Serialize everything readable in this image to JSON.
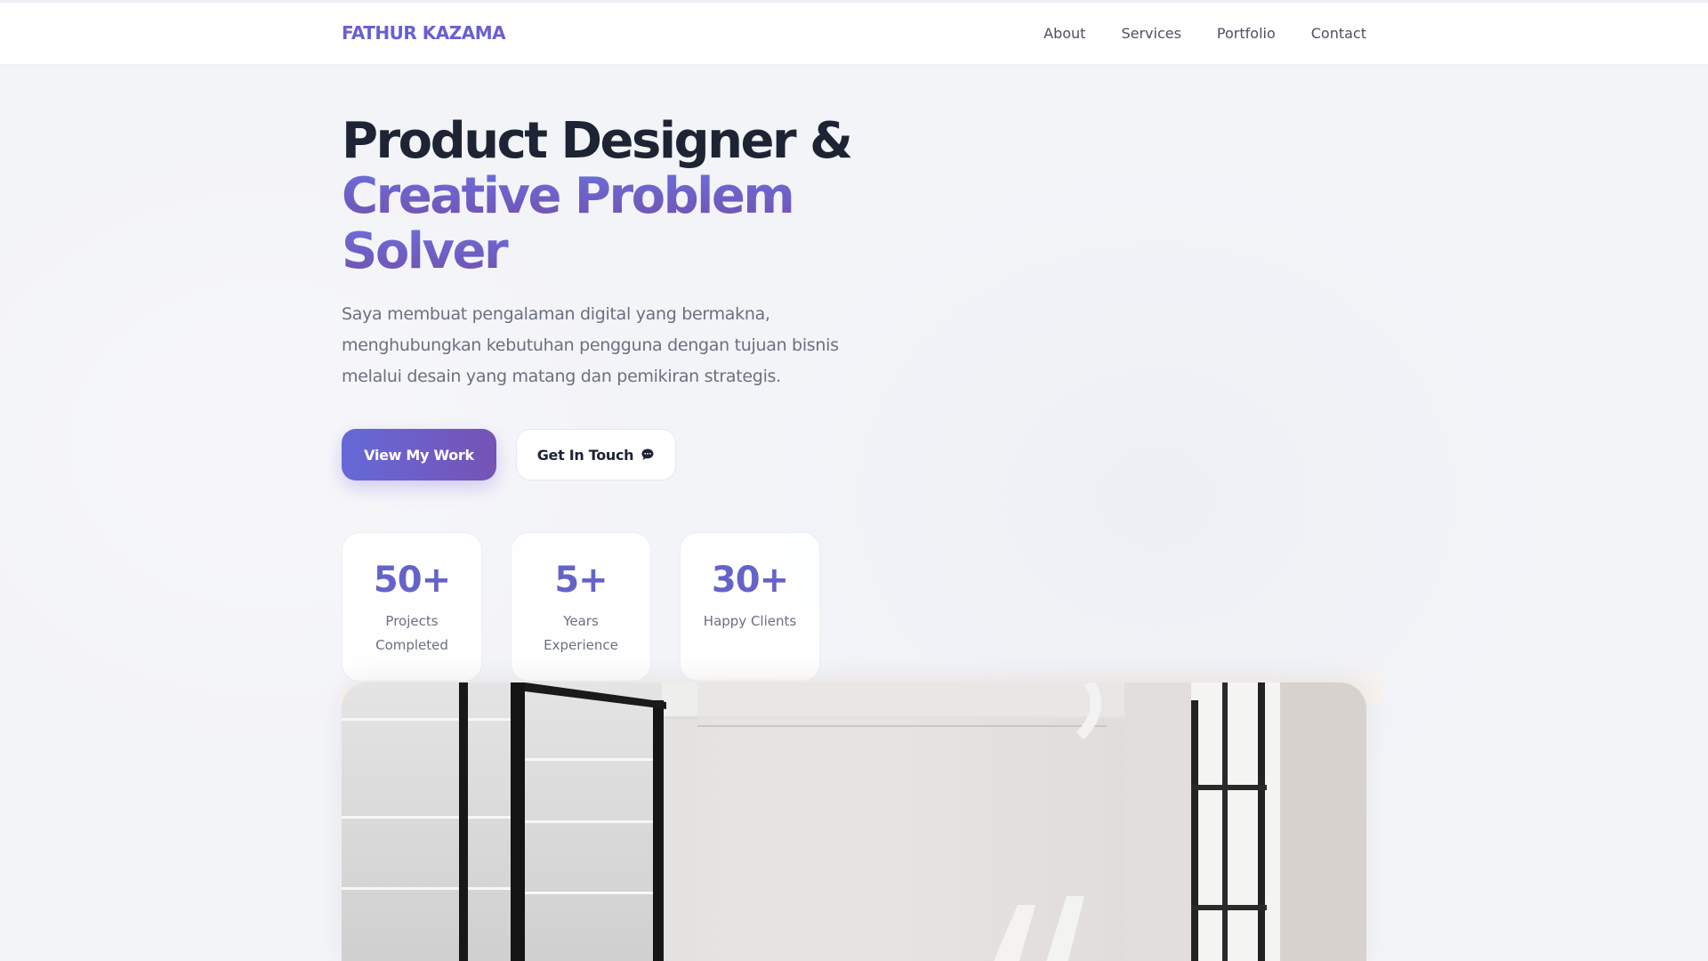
{
  "brand": {
    "logo": "FATHUR KAZAMA"
  },
  "nav": {
    "items": [
      {
        "label": "About"
      },
      {
        "label": "Services"
      },
      {
        "label": "Portfolio"
      },
      {
        "label": "Contact"
      }
    ]
  },
  "hero": {
    "line1": "Product Designer &",
    "line2": "Creative Problem",
    "line3": "Solver",
    "description": "Saya membuat pengalaman digital yang bermakna, menghubungkan kebutuhan pengguna dengan tujuan bisnis melalui desain yang matang dan pemikiran strategis."
  },
  "buttons": {
    "primary": "View My Work",
    "secondary": "Get In Touch",
    "secondary_icon": "chat-bubble-icon"
  },
  "stats": [
    {
      "value": "50+",
      "label": "Projects Completed"
    },
    {
      "value": "5+",
      "label": "Years Experience"
    },
    {
      "value": "30+",
      "label": "Happy Clients"
    }
  ],
  "colors": {
    "accent": "#6a5fd0",
    "gradient_start": "#6669d8",
    "gradient_end": "#7553b4",
    "heading": "#1d2433",
    "body_text": "#6a7080"
  }
}
